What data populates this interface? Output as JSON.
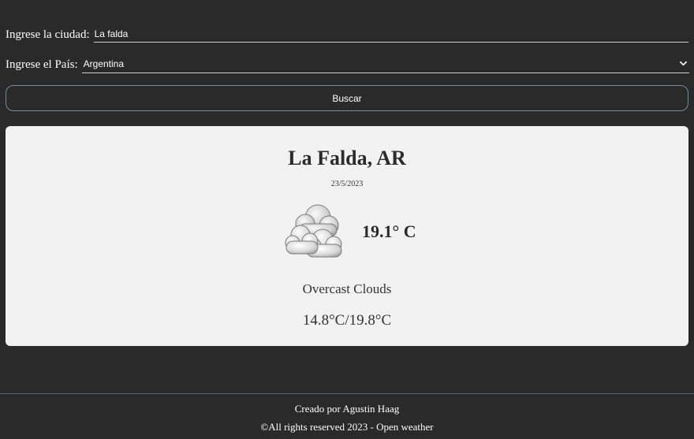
{
  "form": {
    "city_label": "Ingrese la ciudad:",
    "city_value": "La falda",
    "country_label": "Ingrese el País:",
    "country_value": "Argentina",
    "search_button": "Buscar"
  },
  "weather": {
    "location": "La Falda, AR",
    "date": "23/5/2023",
    "icon": "overcast-clouds-icon",
    "temperature": "19.1° C",
    "description": "Overcast Clouds",
    "min_max": "14.8°C/19.8°C"
  },
  "footer": {
    "credit": "Creado por Agustin Haag",
    "rights": "©All rights reserved 2023 - Open weather"
  },
  "colors": {
    "background": "#2a2a2a",
    "card": "#f2f2f2",
    "button_border": "#6c8f9a",
    "text_dark": "#2b2b2b"
  }
}
